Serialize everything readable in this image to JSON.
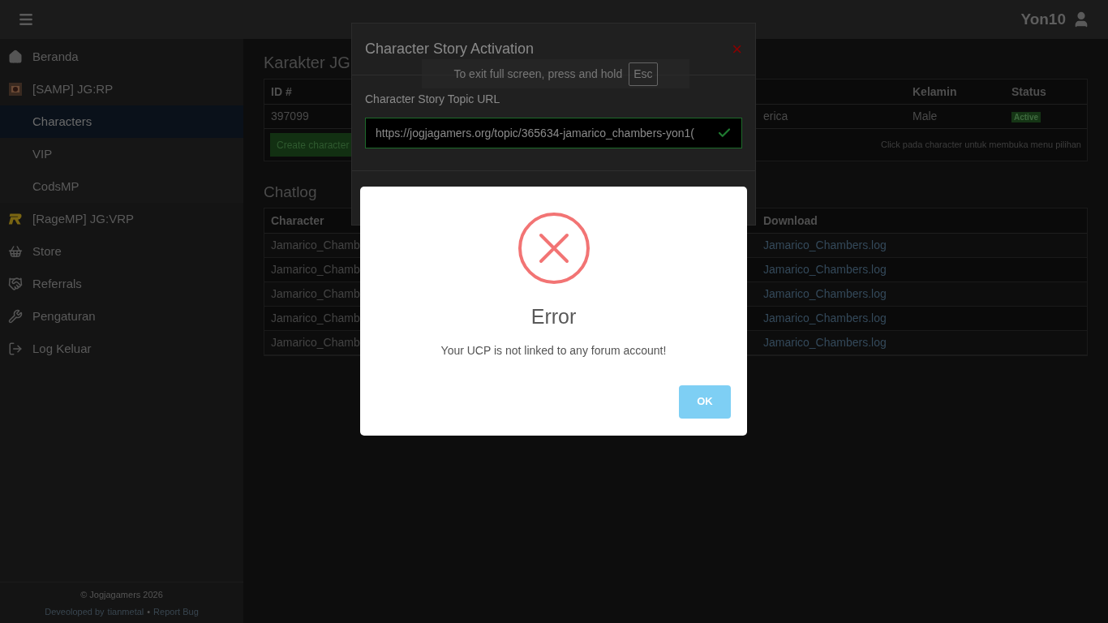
{
  "topbar": {
    "user": "Yon10"
  },
  "sidebar": {
    "items": [
      {
        "label": "Beranda",
        "selected": false
      },
      {
        "label": "[SAMP] JG:RP",
        "selected": false,
        "children": [
          {
            "label": "Characters",
            "selected": true
          },
          {
            "label": "VIP",
            "selected": false
          },
          {
            "label": "CodsMP",
            "selected": false
          }
        ]
      },
      {
        "label": "[RageMP] JG:VRP",
        "selected": false
      },
      {
        "label": "Store",
        "selected": false
      },
      {
        "label": "Referrals",
        "selected": false
      },
      {
        "label": "Pengaturan",
        "selected": false
      },
      {
        "label": "Log Keluar",
        "selected": false
      }
    ],
    "footer": {
      "copyright": "© Jogjagamers 2026",
      "credit_prefix": "Deveoloped by",
      "credit_link": "tianmetal",
      "separator": "•",
      "report_link": "Report Bug"
    }
  },
  "characters": {
    "title": "Karakter JG",
    "columns": [
      "ID #",
      "",
      "",
      "Kelamin",
      "Status"
    ],
    "rows": [
      {
        "cells": [
          "397099",
          "",
          "erica",
          "Male"
        ],
        "status": "Active"
      }
    ],
    "create_button": "Create character",
    "hint": "Click pada character untuk membuka menu pilihan"
  },
  "chatlog": {
    "title": "Chatlog",
    "columns": [
      "Character",
      "",
      "Download"
    ],
    "rows": [
      {
        "character": "Jamarico_Chamb",
        "download": "Jamarico_Chambers.log"
      },
      {
        "character": "Jamarico_Chamb",
        "download": "Jamarico_Chambers.log"
      },
      {
        "character": "Jamarico_Chamb",
        "download": "Jamarico_Chambers.log"
      },
      {
        "character": "Jamarico_Chamb",
        "download": "Jamarico_Chambers.log"
      },
      {
        "character": "Jamarico_Chamb",
        "download": "Jamarico_Chambers.log"
      }
    ]
  },
  "story_modal": {
    "title": "Character Story Activation",
    "close": "×",
    "field_label": "Character Story Topic URL",
    "field_value": "https://jogjagamers.org/topic/365634-jamarico_chambers-yon1(",
    "valid": true
  },
  "fullscreen_notice": {
    "text": "To exit full screen, press and hold",
    "key": "Esc"
  },
  "error_dialog": {
    "title": "Error",
    "message": "Your UCP is not linked to any forum account!",
    "button": "OK"
  }
}
